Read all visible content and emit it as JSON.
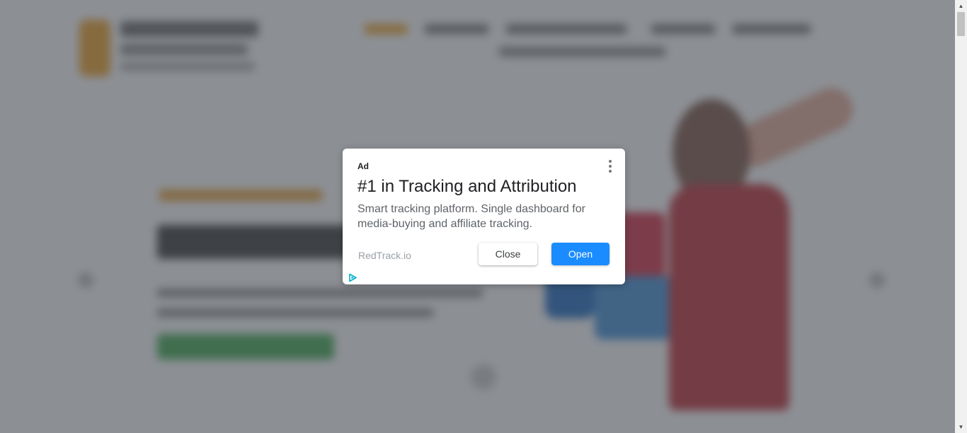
{
  "ad": {
    "label": "Ad",
    "title": "#1 in Tracking and Attribution",
    "description": "Smart tracking platform. Single dashboard for media-buying and affiliate tracking.",
    "domain": "RedTrack.io",
    "close_label": "Close",
    "open_label": "Open",
    "menu_icon": "kebab-menu-icon",
    "adchoices_icon": "adchoices-icon"
  },
  "colors": {
    "open_button": "#1a8cff",
    "overlay": "rgba(70,75,82,0.62)",
    "adchoices": "#00aecd"
  },
  "scrollbar": {
    "up_icon": "▲",
    "down_icon": "▼"
  }
}
